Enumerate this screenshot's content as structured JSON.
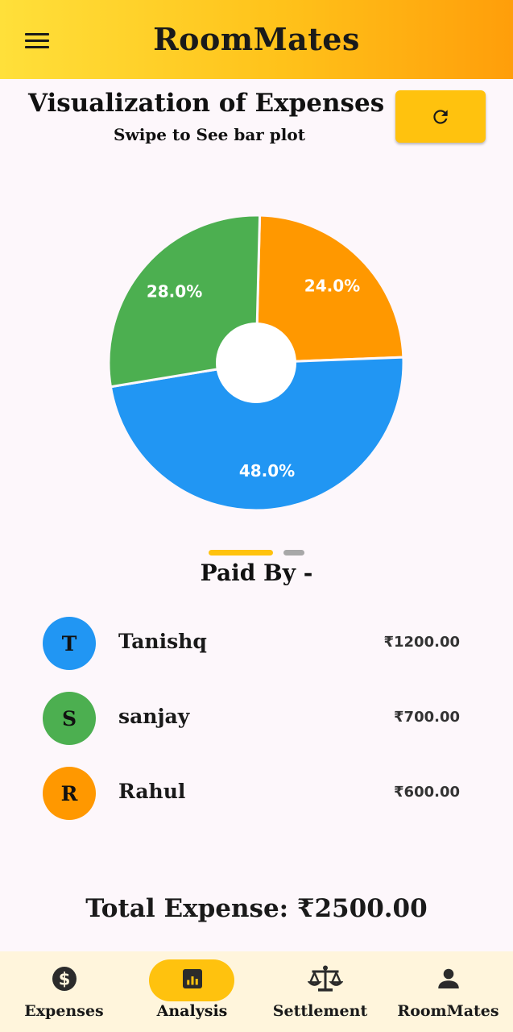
{
  "app": {
    "title": "RoomMates"
  },
  "header": {
    "heading": "Visualization of Expenses",
    "subheading": "Swipe to See bar plot"
  },
  "chart_data": {
    "type": "pie",
    "donut": true,
    "slices": [
      {
        "label": "Rahul",
        "value": 24.0,
        "display": "24.0%",
        "color": "#ff9800"
      },
      {
        "label": "Tanishq",
        "value": 48.0,
        "display": "48.0%",
        "color": "#2196f3"
      },
      {
        "label": "sanjay",
        "value": 28.0,
        "display": "28.0%",
        "color": "#4caf50"
      }
    ]
  },
  "pager": {
    "pages": 2,
    "active": 0
  },
  "paid_by": {
    "title": "Paid By -",
    "items": [
      {
        "initial": "T",
        "name": "Tanishq",
        "amount": "₹1200.00",
        "color": "#2196f3"
      },
      {
        "initial": "S",
        "name": "sanjay",
        "amount": "₹700.00",
        "color": "#4caf50"
      },
      {
        "initial": "R",
        "name": "Rahul",
        "amount": "₹600.00",
        "color": "#ff9800"
      }
    ]
  },
  "total": {
    "text": "Total Expense: ₹2500.00"
  },
  "nav": {
    "active": "analysis",
    "items": [
      {
        "key": "expenses",
        "label": "Expenses",
        "icon": "dollar-circle-icon"
      },
      {
        "key": "analysis",
        "label": "Analysis",
        "icon": "bar-chart-icon"
      },
      {
        "key": "settlement",
        "label": "Settlement",
        "icon": "balance-scale-icon"
      },
      {
        "key": "roommates",
        "label": "RoomMates",
        "icon": "person-icon"
      }
    ]
  },
  "colors": {
    "accent": "#ffc20e",
    "background": "#fdf7fb",
    "nav_background": "#fff5dc"
  }
}
